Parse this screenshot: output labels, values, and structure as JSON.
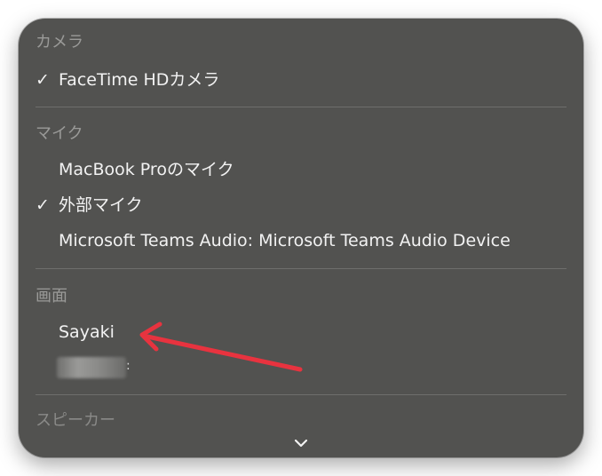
{
  "camera": {
    "header": "カメラ",
    "items": [
      {
        "label": "FaceTime HDカメラ",
        "checked": true
      }
    ]
  },
  "microphone": {
    "header": "マイク",
    "items": [
      {
        "label": "MacBook Proのマイク",
        "checked": false
      },
      {
        "label": "外部マイク",
        "checked": true
      },
      {
        "label": "Microsoft Teams Audio: Microsoft Teams Audio Device",
        "checked": false
      }
    ]
  },
  "screen": {
    "header": "画面",
    "items": [
      {
        "label": "Sayaki",
        "checked": false
      }
    ],
    "redacted_tail": ":"
  },
  "speaker": {
    "header": "スピーカー"
  },
  "checkmark": "✓",
  "icons": {
    "more_indicator": "chevron-down-icon",
    "annotation": "red-arrow-icon"
  },
  "colors": {
    "menu_background": "#525250",
    "header_text": "#9a9a98",
    "item_text": "#f2f2f2",
    "annotation_arrow": "#e8333f"
  }
}
